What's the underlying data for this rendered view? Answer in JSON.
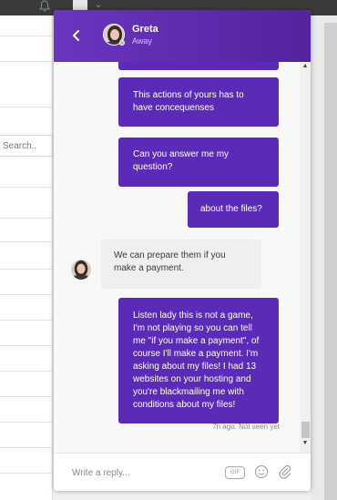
{
  "background": {
    "search_placeholder": "Search.."
  },
  "header": {
    "name": "Greta",
    "status": "Away"
  },
  "messages": [
    {
      "dir": "out",
      "text": "This actions of yours has to have concequenses"
    },
    {
      "dir": "out",
      "text": "Can you answer me my question?"
    },
    {
      "dir": "out",
      "text": "about the files?"
    },
    {
      "dir": "in",
      "text": "We can prepare them if you make a payment."
    },
    {
      "dir": "out",
      "text": "Listen lady this is not a game, I'm not playing so you can tell me \"if you make a payment\", of course I'll make a payment. I'm asking about my files! I had 13 websites on your hosting and you're blackmailing me with conditions about my files!"
    }
  ],
  "meta": "7h ago. Not seen yet",
  "composer": {
    "placeholder": "Write a reply...",
    "gif_label": "GIF"
  },
  "icons": {
    "back": "chevron-left-icon",
    "emoji": "smiley-icon",
    "attach": "paperclip-icon",
    "bell": "bell-icon"
  },
  "colors": {
    "header_start": "#6a35bf",
    "header_end": "#53239f",
    "outgoing_bubble": "#5b2ab7",
    "incoming_bubble": "#efefef"
  }
}
